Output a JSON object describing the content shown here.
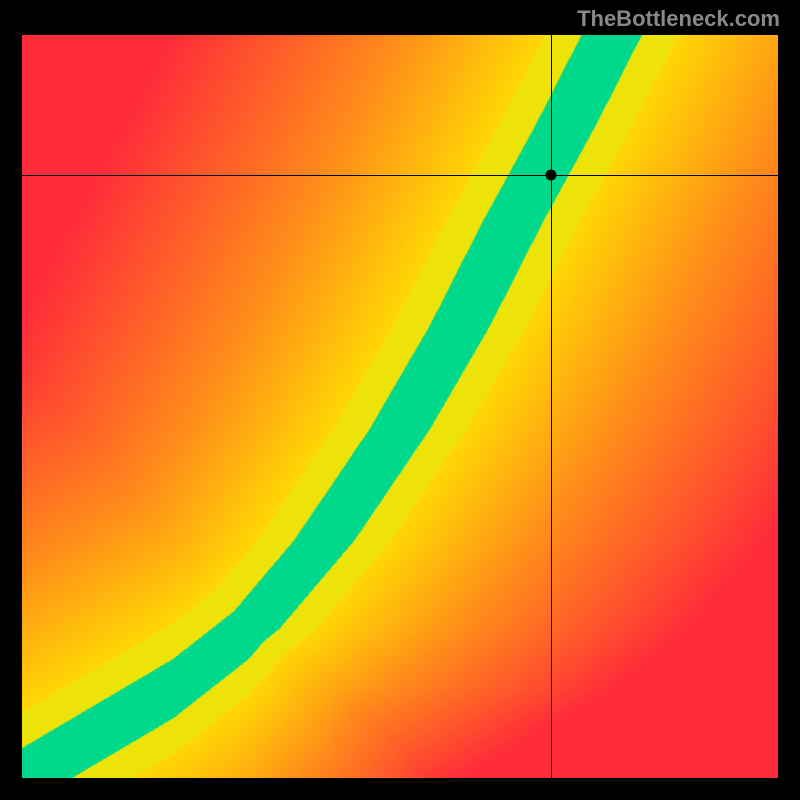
{
  "watermark": "TheBottleneck.com",
  "chart_data": {
    "type": "heatmap",
    "description": "Bottleneck compatibility heatmap with crosshair marker. Diagonal green ridge (low-left to upper-right) indicates optimal matching zone; red regions indicate mismatch.",
    "x_range": [
      0,
      100
    ],
    "y_range": [
      0,
      100
    ],
    "ridge_center": [
      {
        "x": 0,
        "y": 0
      },
      {
        "x": 10,
        "y": 6
      },
      {
        "x": 20,
        "y": 12
      },
      {
        "x": 30,
        "y": 20
      },
      {
        "x": 40,
        "y": 32
      },
      {
        "x": 50,
        "y": 47
      },
      {
        "x": 58,
        "y": 61
      },
      {
        "x": 65,
        "y": 75
      },
      {
        "x": 72,
        "y": 88
      },
      {
        "x": 78,
        "y": 100
      }
    ],
    "ridge_half_width_pct": 4,
    "color_scale": [
      {
        "stop": 0.0,
        "color": "#ff2a3a",
        "meaning": "poor match"
      },
      {
        "stop": 0.4,
        "color": "#ff8c1a",
        "meaning": "weak match"
      },
      {
        "stop": 0.7,
        "color": "#ffe400",
        "meaning": "near match"
      },
      {
        "stop": 1.0,
        "color": "#00d98b",
        "meaning": "optimal"
      }
    ],
    "marker": {
      "x_pct": 70.0,
      "y_pct": 81.2
    },
    "crosshair": {
      "x_pct": 70.0,
      "y_pct": 81.2
    }
  }
}
